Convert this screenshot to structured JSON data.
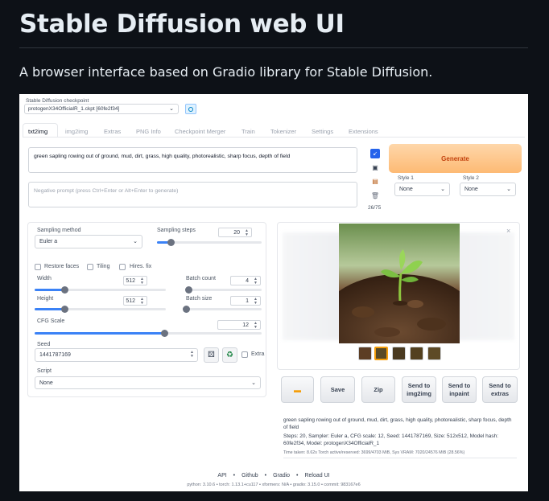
{
  "page": {
    "title": "Stable Diffusion web UI",
    "subtitle": "A browser interface based on Gradio library for Stable Diffusion."
  },
  "checkpoint": {
    "label": "Stable Diffusion checkpoint",
    "value": "protogenX34OfficialR_1.ckpt [60fe2f34]"
  },
  "tabs": [
    {
      "label": "txt2img",
      "active": true
    },
    {
      "label": "img2img"
    },
    {
      "label": "Extras"
    },
    {
      "label": "PNG Info"
    },
    {
      "label": "Checkpoint Merger"
    },
    {
      "label": "Train"
    },
    {
      "label": "Tokenizer"
    },
    {
      "label": "Settings"
    },
    {
      "label": "Extensions"
    }
  ],
  "prompt": {
    "value": "green sapling rowing out of ground, mud, dirt, grass, high quality, photorealistic, sharp focus, depth of field",
    "negative_placeholder": "Negative prompt (press Ctrl+Enter or Alt+Enter to generate)",
    "token_count": "26/75"
  },
  "generate": {
    "label": "Generate",
    "style1_label": "Style 1",
    "style1_value": "None",
    "style2_label": "Style 2",
    "style2_value": "None"
  },
  "settings": {
    "sampling_method_label": "Sampling method",
    "sampling_method_value": "Euler a",
    "sampling_steps_label": "Sampling steps",
    "sampling_steps_value": "20",
    "sampling_steps_fraction": 0.13,
    "restore_faces": "Restore faces",
    "tiling": "Tiling",
    "hires_fix": "Hires. fix",
    "width_label": "Width",
    "width_value": "512",
    "width_fraction": 0.23,
    "height_label": "Height",
    "height_value": "512",
    "height_fraction": 0.23,
    "batch_count_label": "Batch count",
    "batch_count_value": "4",
    "batch_count_fraction": 0.03,
    "batch_size_label": "Batch size",
    "batch_size_value": "1",
    "batch_size_fraction": 0.0,
    "cfg_label": "CFG Scale",
    "cfg_value": "12",
    "cfg_fraction": 0.57,
    "seed_label": "Seed",
    "seed_value": "1441787169",
    "extra_label": "Extra",
    "script_label": "Script",
    "script_value": "None"
  },
  "output": {
    "save": "Save",
    "zip": "Zip",
    "send_img2img": "Send to img2img",
    "send_inpaint": "Send to inpaint",
    "send_extras": "Send to extras",
    "info_prompt": "green sapling rowing out of ground, mud, dirt, grass, high quality, photorealistic, sharp focus, depth of field",
    "info_params": "Steps: 20, Sampler: Euler a, CFG scale: 12, Seed: 1441787169, Size: 512x512, Model hash: 60fe2f34, Model: protogenX34OfficialR_1",
    "info_time": "Time taken: 8.62s  Torch active/reserved: 3699/4703 MiB, Sys VRAM: 7020/24576 MiB (28.56%)"
  },
  "footer": {
    "api": "API",
    "github": "Github",
    "gradio": "Gradio",
    "reload": "Reload UI",
    "versions": "python: 3.10.6  •  torch: 1.13.1+cu117  •  xformers: N/A  •  gradio: 3.15.0  •  commit: 983167e6"
  },
  "colors": {
    "accent": "#3b82f6",
    "generate_bg": "#fdba74",
    "generate_text": "#c2410c",
    "page_bg": "#0d1117"
  }
}
